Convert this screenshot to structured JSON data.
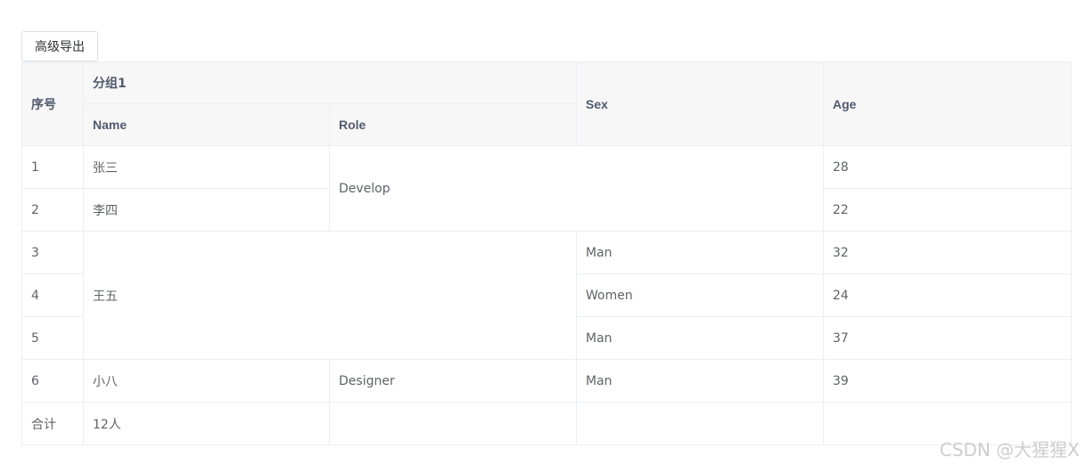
{
  "toolbar": {
    "export_label": "高级导出"
  },
  "table": {
    "headers": {
      "index": "序号",
      "group": "分组1",
      "name": "Name",
      "role": "Role",
      "sex": "Sex",
      "age": "Age"
    },
    "rows": [
      {
        "index": "1",
        "name": "张三",
        "role": "Develop",
        "sex": "",
        "age": "28"
      },
      {
        "index": "2",
        "name": "李四",
        "age": "22"
      },
      {
        "index": "3",
        "name": "王五",
        "sex": "Man",
        "age": "32"
      },
      {
        "index": "4",
        "sex": "Women",
        "age": "24"
      },
      {
        "index": "5",
        "sex": "Man",
        "age": "37"
      },
      {
        "index": "6",
        "name": "小八",
        "role": "Designer",
        "sex": "Man",
        "age": "39"
      }
    ],
    "footer": {
      "label": "合计",
      "name": "12人",
      "role": "",
      "sex": "",
      "age": ""
    }
  },
  "watermark": "CSDN @大猩猩X"
}
